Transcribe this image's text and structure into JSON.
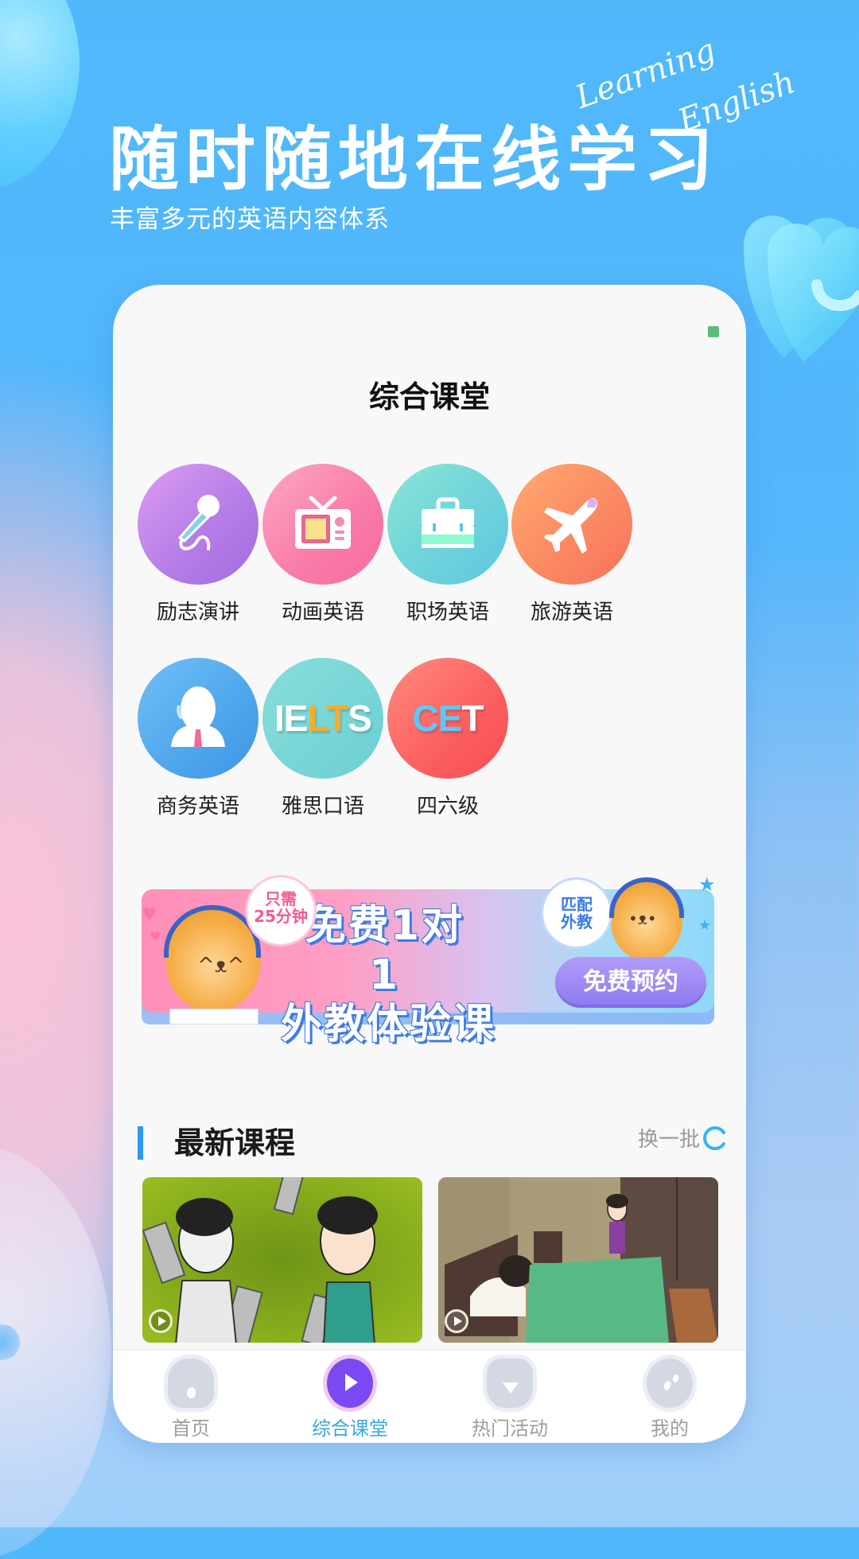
{
  "hero": {
    "title": "随时随地在线学习",
    "subtitle": "丰富多元的英语内容体系",
    "script_line1": "Learning",
    "script_line2": "English"
  },
  "phone": {
    "page_title": "综合课堂",
    "categories": [
      {
        "label": "励志演讲",
        "icon": "microphone-icon",
        "color": "#b67ee7"
      },
      {
        "label": "动画英语",
        "icon": "tv-icon",
        "color": "#f97aa8"
      },
      {
        "label": "职场英语",
        "icon": "briefcase-icon",
        "color": "#6fd3da"
      },
      {
        "label": "旅游英语",
        "icon": "airplane-icon",
        "color": "#fb8a63"
      },
      {
        "label": "商务英语",
        "icon": "business-person-icon",
        "color": "#4ea6ec"
      },
      {
        "label": "雅思口语",
        "icon": "ielts-logo-icon",
        "logo_text_a": "IE",
        "logo_text_b": "LT",
        "logo_text_c": "S",
        "color": "#6ccfd2"
      },
      {
        "label": "四六级",
        "icon": "cet-logo-icon",
        "logo_text_a": "CE",
        "logo_text_b": "T",
        "color": "#fb5f5f"
      }
    ],
    "banner": {
      "main_line1": "免费1对1",
      "main_line2": "外教体验课",
      "note_left_line1": "只需",
      "note_left_line2": "25分钟",
      "note_right_line1": "匹配",
      "note_right_line2": "外教",
      "button_label": "免费预约"
    },
    "latest": {
      "title": "最新课程",
      "refresh_label": "换一批",
      "accent_color": "#2d97f5"
    },
    "tabs": [
      {
        "label": "首页",
        "icon": "home-icon",
        "active": false
      },
      {
        "label": "综合课堂",
        "icon": "play-icon",
        "active": true
      },
      {
        "label": "热门活动",
        "icon": "gift-bag-icon",
        "active": false
      },
      {
        "label": "我的",
        "icon": "profile-icon",
        "active": false
      }
    ],
    "active_tab_color": "#3ba7e0"
  }
}
